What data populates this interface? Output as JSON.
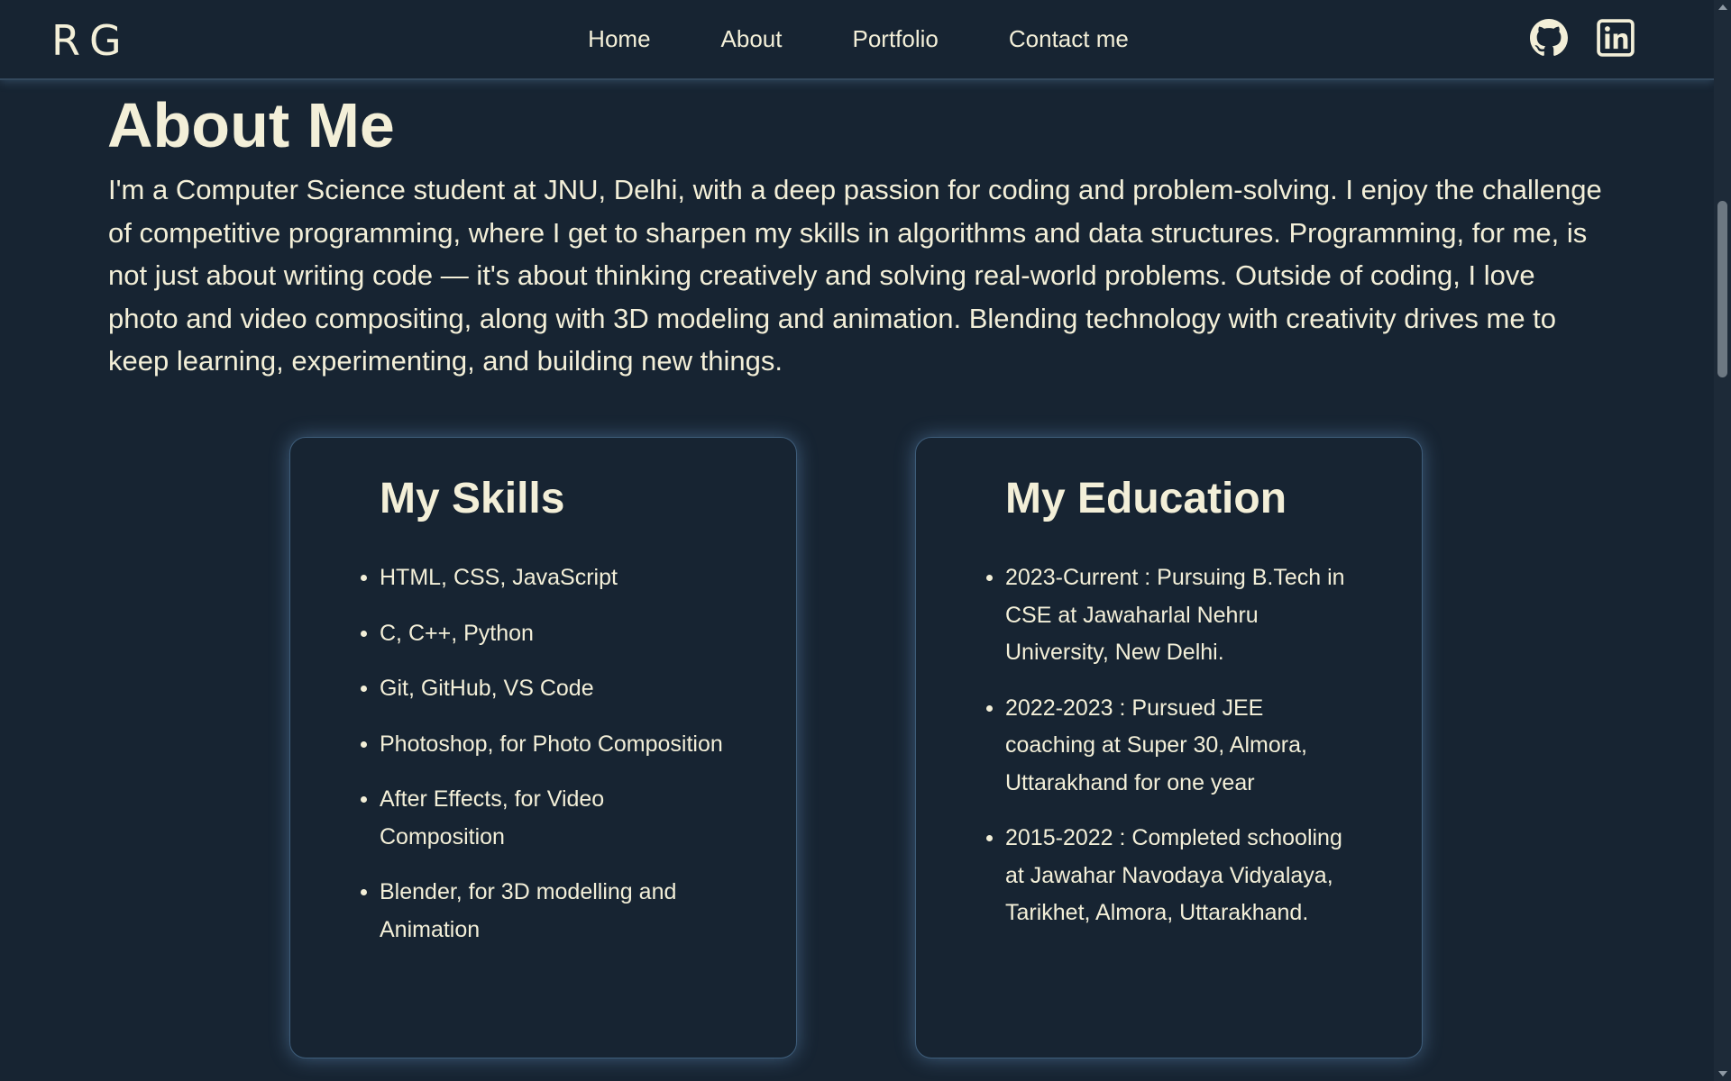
{
  "header": {
    "logo": "RG",
    "nav": [
      "Home",
      "About",
      "Portfolio",
      "Contact me"
    ],
    "social_icons": [
      "github-icon",
      "linkedin-icon"
    ]
  },
  "about": {
    "title": "About Me",
    "text": "I'm a Computer Science student at JNU, Delhi, with a deep passion for coding and problem-solving. I enjoy the challenge of competitive programming, where I get to sharpen my skills in algorithms and data structures. Programming, for me, is not just about writing code — it's about thinking creatively and solving real-world problems. Outside of coding, I love photo and video compositing, along with 3D modeling and animation. Blending technology with creativity drives me to keep learning, experimenting, and building new things."
  },
  "skills": {
    "title": "My Skills",
    "items": [
      "HTML, CSS, JavaScript",
      "C, C++, Python",
      "Git, GitHub, VS Code",
      "Photoshop, for Photo Composition",
      "After Effects, for Video Composition",
      "Blender, for 3D modelling and Animation"
    ]
  },
  "education": {
    "title": "My Education",
    "items": [
      "2023-Current : Pursuing B.Tech in CSE at Jawaharlal Nehru University, New Delhi.",
      "2022-2023 : Pursued JEE coaching at Super 30, Almora, Uttarakhand for one year",
      "2015-2022 : Completed schooling at Jawahar Navodaya Vidyalaya, Tarikhet, Almora, Uttarakhand."
    ]
  },
  "colors": {
    "background": "#172432",
    "text": "#f3efd8",
    "card_border": "#3e5d7a",
    "glow": "#6ea0d2"
  }
}
